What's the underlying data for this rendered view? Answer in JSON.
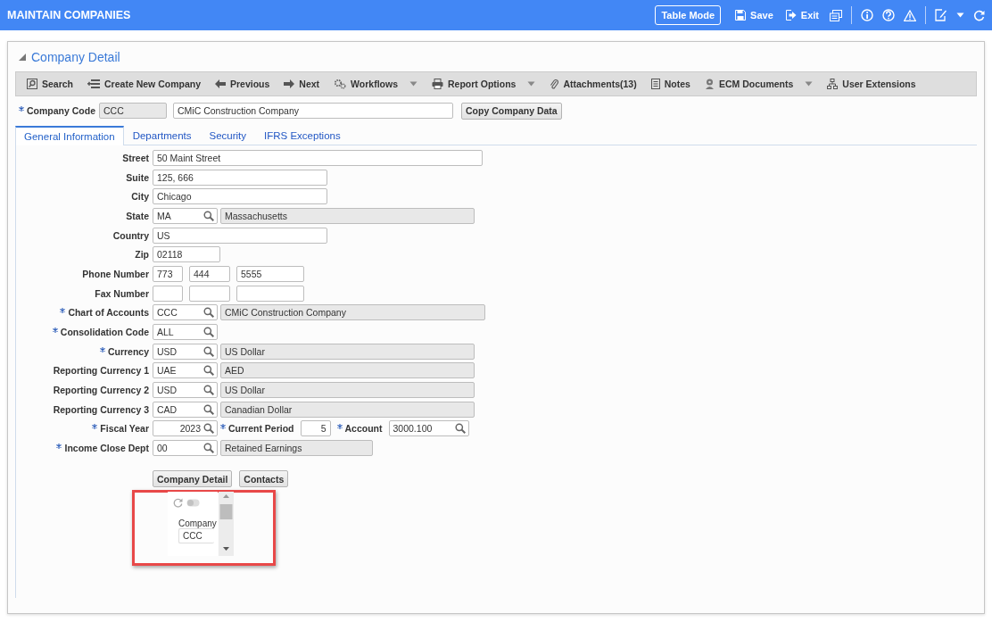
{
  "window": {
    "title": "MAINTAIN COMPANIES"
  },
  "header_buttons": [
    {
      "kind": "outlined",
      "label": "Table Mode"
    },
    {
      "kind": "icon",
      "label": "Save"
    },
    {
      "kind": "icon",
      "label": "Exit"
    }
  ],
  "section": {
    "title": "Company Detail",
    "expanded": true
  },
  "toolbar": [
    {
      "label": "Search",
      "menu": false
    },
    {
      "label": "Create New Company",
      "menu": false
    },
    {
      "label": "Previous",
      "menu": false
    },
    {
      "label": "Next",
      "menu": false
    },
    {
      "label": "Workflows",
      "menu": true
    },
    {
      "label": "Report Options",
      "menu": true
    },
    {
      "label": "Attachments(13)",
      "menu": false
    },
    {
      "label": "Notes",
      "menu": false
    },
    {
      "label": "ECM Documents",
      "menu": true
    },
    {
      "label": "User Extensions",
      "menu": false
    }
  ],
  "company_code": {
    "label": "Company Code",
    "required": true,
    "code": "CCC",
    "name": "CMiC Construction Company",
    "button": "Copy Company Data"
  },
  "tabs": [
    {
      "label": "General Information",
      "selected": true
    },
    {
      "label": "Departments",
      "selected": false
    },
    {
      "label": "Security",
      "selected": false
    },
    {
      "label": "IFRS Exceptions",
      "selected": false
    }
  ],
  "form": [
    {
      "label": "Street",
      "required": false,
      "fields": [
        {
          "kind": "text",
          "value": "50 Maint Street"
        }
      ]
    },
    {
      "label": "Suite",
      "required": false,
      "fields": [
        {
          "kind": "text",
          "value": "125, 666"
        }
      ]
    },
    {
      "label": "City",
      "required": false,
      "fields": [
        {
          "kind": "text",
          "value": "Chicago"
        }
      ]
    },
    {
      "label": "State",
      "required": false,
      "fields": [
        {
          "kind": "lookup",
          "value": "MA"
        },
        {
          "kind": "description",
          "value": "Massachusetts"
        }
      ]
    },
    {
      "label": "Country",
      "required": false,
      "fields": [
        {
          "kind": "text",
          "value": "US"
        }
      ]
    },
    {
      "label": "Zip",
      "required": false,
      "fields": [
        {
          "kind": "text",
          "value": "02118"
        }
      ]
    },
    {
      "label": "Phone Number",
      "required": false,
      "fields": [
        {
          "kind": "text",
          "value": "773"
        },
        {
          "kind": "text",
          "value": "444"
        },
        {
          "kind": "text",
          "value": "5555"
        }
      ]
    },
    {
      "label": "Fax Number",
      "required": false,
      "fields": [
        {
          "kind": "text"
        },
        {
          "kind": "text"
        },
        {
          "kind": "text"
        }
      ]
    },
    {
      "label": "Chart of Accounts",
      "required": true,
      "fields": [
        {
          "kind": "lookup",
          "value": "CCC"
        },
        {
          "kind": "description",
          "value": "CMiC Construction Company"
        }
      ]
    },
    {
      "label": "Consolidation Code",
      "required": true,
      "fields": [
        {
          "kind": "lookup",
          "value": "ALL"
        }
      ]
    },
    {
      "label": "Currency",
      "required": true,
      "fields": [
        {
          "kind": "lookup",
          "value": "USD"
        },
        {
          "kind": "description",
          "value": "US Dollar"
        }
      ]
    },
    {
      "label": "Reporting Currency 1",
      "required": false,
      "fields": [
        {
          "kind": "lookup",
          "value": "UAE"
        },
        {
          "kind": "description",
          "value": "AED"
        }
      ]
    },
    {
      "label": "Reporting Currency 2",
      "required": false,
      "fields": [
        {
          "kind": "lookup",
          "value": "USD"
        },
        {
          "kind": "description",
          "value": "US Dollar"
        }
      ]
    },
    {
      "label": "Reporting Currency 3",
      "required": false,
      "fields": [
        {
          "kind": "lookup",
          "value": "CAD"
        },
        {
          "kind": "description",
          "value": "Canadian Dollar"
        }
      ]
    },
    {
      "label": "Fiscal Year",
      "required": true,
      "fields": [
        {
          "kind": "number-lookup",
          "value": "2023"
        },
        {
          "kind": "label",
          "value": "Current Period",
          "required": true
        },
        {
          "kind": "number",
          "value": "5"
        },
        {
          "kind": "label",
          "value": "Account",
          "required": true
        },
        {
          "kind": "lookup",
          "value": "3000.100"
        }
      ]
    },
    {
      "label": "Income Close Dept",
      "required": true,
      "fields": [
        {
          "kind": "lookup",
          "value": "00"
        },
        {
          "kind": "description",
          "value": "Retained Earnings"
        }
      ]
    }
  ],
  "buttons": [
    "Company Detail",
    "Contacts"
  ],
  "widget": {
    "label": "Company",
    "value": "CCC",
    "toggle_on": false
  }
}
